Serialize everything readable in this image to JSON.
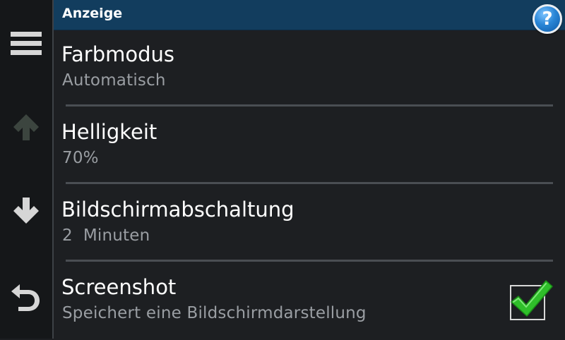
{
  "header": {
    "title": "Anzeige",
    "help_label": "?"
  },
  "sidebar": {
    "buttons": [
      {
        "icon": "menu-icon",
        "enabled": true
      },
      {
        "icon": "arrow-up-icon",
        "enabled": false
      },
      {
        "icon": "arrow-down-icon",
        "enabled": true
      },
      {
        "icon": "back-icon",
        "enabled": true
      }
    ]
  },
  "settings": [
    {
      "label": "Farbmodus",
      "value": "Automatisch"
    },
    {
      "label": "Helligkeit",
      "value": "70%"
    },
    {
      "label": "Bildschirmabschaltung",
      "value": "2  Minuten"
    },
    {
      "label": "Screenshot",
      "value": "Speichert eine Bildschirmdarstellung",
      "checked": true
    }
  ],
  "colors": {
    "header_bg": "#123d5e",
    "background": "#1d1f22",
    "check_green": "#2fbf2a"
  }
}
